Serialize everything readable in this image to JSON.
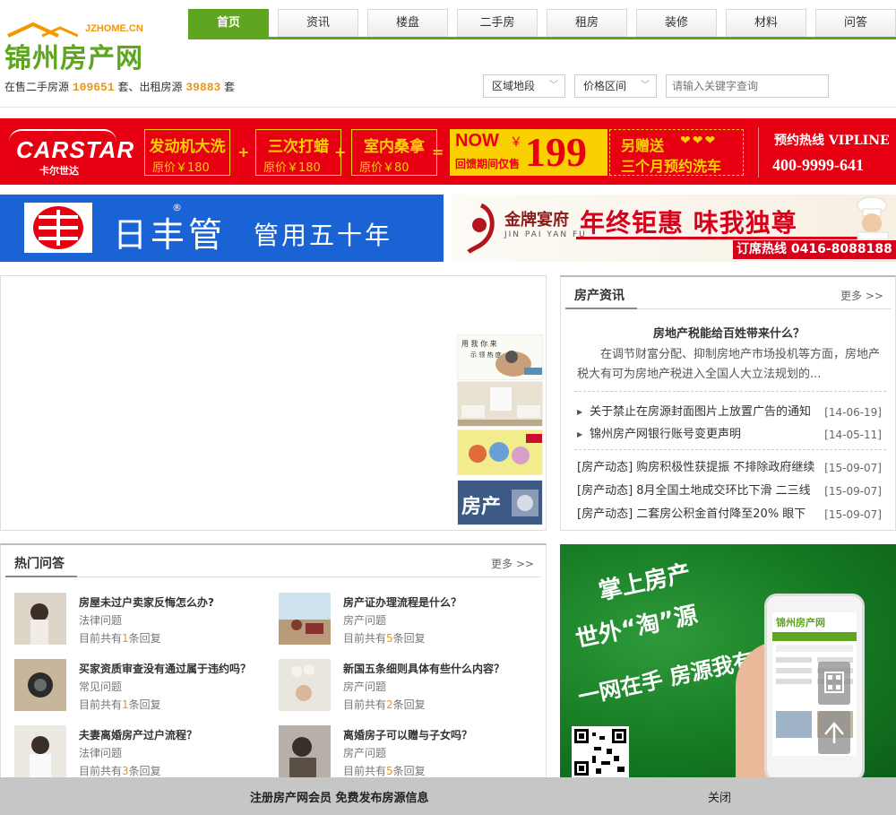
{
  "logo": {
    "domain": "JZHOME.CN",
    "name": "锦州房产网"
  },
  "stats": {
    "prefix": "在售二手房源",
    "sale_count": "109651",
    "mid": "套、出租房源",
    "rent_count": "39883",
    "suffix": "套"
  },
  "nav": [
    "首页",
    "资讯",
    "楼盘",
    "二手房",
    "租房",
    "装修",
    "材料",
    "问答"
  ],
  "filters": {
    "area": "区域地段",
    "price": "价格区间",
    "search_placeholder": "请输入关键字查询"
  },
  "banner_carwash": {
    "brand": "CARSTAR",
    "brand_sub": "卡尔世达",
    "services": [
      {
        "name": "发动机大洗",
        "price": "原价￥180"
      },
      {
        "name": "三次打蜡",
        "price": "原价￥180"
      },
      {
        "name": "室内桑拿",
        "price": "原价￥80"
      }
    ],
    "plus": "+",
    "equals": "=",
    "now": "NOW",
    "currency": "￥",
    "now_sub": "回馈期间仅售",
    "price": "199",
    "gift_line1": "另赠送",
    "hearts": "❤❤❤",
    "gift_line2": "三个月预约洗车",
    "hotline_label": "预约热线 VIPLINE",
    "hotline": "400-9999-641"
  },
  "banner_pipe": {
    "reg": "®",
    "name": "日丰管",
    "slogan": "管用五十年"
  },
  "banner_restaurant": {
    "brand": "金牌宴府",
    "brand_pinyin": "JIN PAI YAN FU",
    "slogan": "年终钜惠 味我独尊",
    "tel": "订席热线 0416-8088188"
  },
  "news": {
    "title": "房产资讯",
    "more": "更多 >>",
    "headline": "房地产税能给百姓带来什么？",
    "abstract": "在调节财富分配、抑制房地产市场投机等方面，房地产税大有可为房地产税进入全国人大立法规划的...",
    "items": [
      {
        "text": "关于禁止在房源封面图片上放置广告的通知",
        "date": "[14-06-19]"
      },
      {
        "text": "锦州房产网银行账号变更声明",
        "date": "[14-05-11]"
      }
    ],
    "items2": [
      {
        "text": "[房产动态] 购房积极性获提振 不排除政府继续",
        "date": "[15-09-07]"
      },
      {
        "text": "[房产动态] 8月全国土地成交环比下滑 二三线",
        "date": "[15-09-07]"
      },
      {
        "text": "[房产动态] 二套房公积金首付降至20% 眼下",
        "date": "[15-09-07]"
      }
    ]
  },
  "qa": {
    "title": "热门问答",
    "more": "更多 >>",
    "reply_prefix": "目前共有",
    "reply_suffix": "条回复",
    "items": [
      {
        "q": "房屋未过户卖家反悔怎么办?",
        "cat": "法律问题",
        "replies": "1"
      },
      {
        "q": "房产证办理流程是什么？",
        "cat": "房产问题",
        "replies": "5"
      },
      {
        "q": "买家资质审查没有通过属于违约吗？",
        "cat": "常见问题",
        "replies": "1"
      },
      {
        "q": "新国五条细则具体有些什么内容？",
        "cat": "房产问题",
        "replies": "2"
      },
      {
        "q": "夫妻离婚房产过户流程？",
        "cat": "法律问题",
        "replies": "3"
      },
      {
        "q": "离婚房子可以赠与子女吗？",
        "cat": "房产问题",
        "replies": "5"
      }
    ]
  },
  "mobile_ad": {
    "line1": "掌上房产",
    "line2": "世外“淘”源",
    "line3": "一网在手 房源我有"
  },
  "bottom_bar": {
    "register": "注册房产网会员 免费发布房源信息",
    "close": "关闭"
  },
  "colors": {
    "brand_green": "#5ea61f",
    "accent_orange": "#e8961b",
    "banner_red": "#e60012",
    "banner_yellow": "#fbd000",
    "pipe_blue": "#1a63d4"
  }
}
